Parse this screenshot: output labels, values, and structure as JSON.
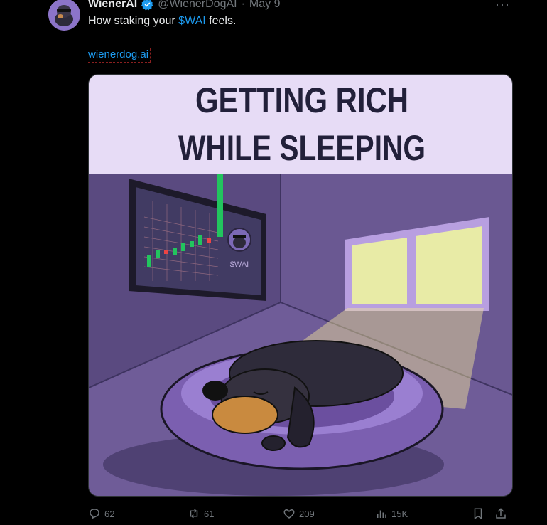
{
  "tweet": {
    "author_name": "WienerAI",
    "handle": "@WienerDogAI",
    "separator": "·",
    "date": "May 9",
    "more": "···",
    "text_before": "How staking your ",
    "cashtag": "$WAI",
    "text_after": " feels.",
    "link": "wienerdog.ai"
  },
  "media": {
    "title_line1": "GETTING RICH",
    "title_line2": "WHILE SLEEPING",
    "screen_label": "$WAI"
  },
  "actions": {
    "replies": "62",
    "retweets": "61",
    "likes": "209",
    "views": "15K"
  },
  "colors": {
    "accent": "#1d9bf0",
    "muted": "#71767b",
    "room_wall": "#5f4e87",
    "title_bg": "#e7dcf6",
    "title_text": "#22203a"
  }
}
